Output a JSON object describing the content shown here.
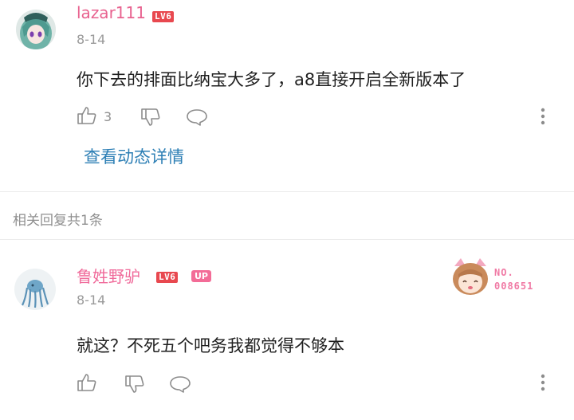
{
  "comment": {
    "username": "lazar111",
    "level": "LV6",
    "date": "8-14",
    "text": "你下去的排面比纳宝大多了，a8直接开启全新版本了",
    "like_count": "3",
    "view_detail_link": "查看动态详情",
    "username_color": "#e8628f"
  },
  "replies_section": {
    "title": "相关回复共1条"
  },
  "reply": {
    "username": "鲁姓野驴",
    "level": "LV6",
    "up_badge": "UP",
    "date": "8-14",
    "text": "就这？不死五个吧务我都觉得不够本",
    "fan_badge_label": "NO.",
    "fan_badge_number": "008651",
    "username_color": "#f06a9a"
  }
}
